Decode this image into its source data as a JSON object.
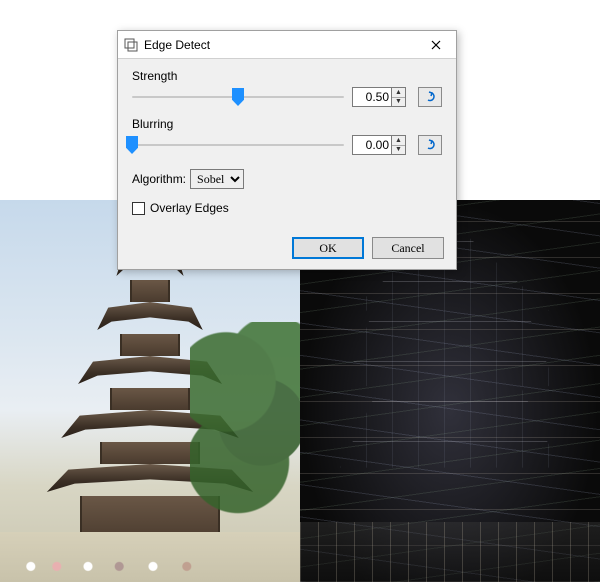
{
  "dialog": {
    "title": "Edge Detect",
    "strength": {
      "label": "Strength",
      "value": "0.50",
      "slider_pos_pct": 50
    },
    "blurring": {
      "label": "Blurring",
      "value": "0.00",
      "slider_pos_pct": 0
    },
    "algorithm": {
      "label": "Algorithm:",
      "selected": "Sobel",
      "options": [
        "Sobel"
      ]
    },
    "overlay": {
      "label": "Overlay Edges",
      "checked": false
    },
    "buttons": {
      "ok": "OK",
      "cancel": "Cancel"
    }
  }
}
